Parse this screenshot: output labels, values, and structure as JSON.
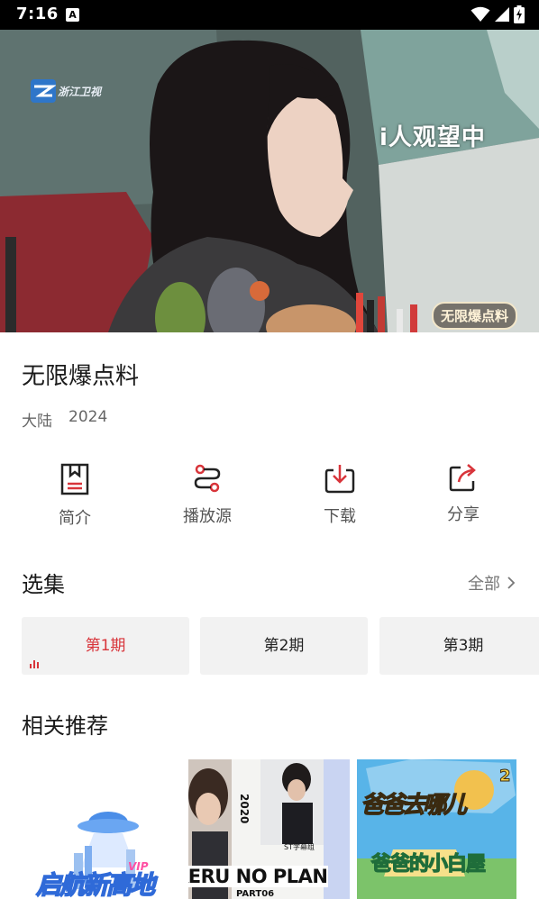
{
  "status_bar": {
    "time": "7:16",
    "notification_icon_letter": "A",
    "icons": [
      "wifi-icon",
      "signal-icon",
      "battery-charging-icon"
    ]
  },
  "player": {
    "channel_watermark": "浙江卫视",
    "viewer_status": "i人观望中",
    "show_logo": "无限爆点料"
  },
  "show": {
    "title": "无限爆点料",
    "region": "大陆",
    "year": "2024"
  },
  "actions": [
    {
      "label": "简介",
      "icon": "document-icon"
    },
    {
      "label": "播放源",
      "icon": "route-icon"
    },
    {
      "label": "下载",
      "icon": "download-icon"
    },
    {
      "label": "分享",
      "icon": "share-icon"
    }
  ],
  "episodes": {
    "title": "选集",
    "see_all": "全部",
    "items": [
      {
        "label": "第1期",
        "active": true
      },
      {
        "label": "第2期",
        "active": false
      },
      {
        "label": "第3期",
        "active": false
      }
    ]
  },
  "recommendations": {
    "title": "相关推荐",
    "posters": [
      {
        "title_art": "启航新高地",
        "badge": "VIP"
      },
      {
        "title_art": "KERU NO PLAN",
        "year_art": "2020",
        "sub_art": "PART06",
        "caption_art": "ST字幕组"
      },
      {
        "title_art": "爸爸的小白屋",
        "top_art": "爸爸去哪儿",
        "badge": "2"
      }
    ]
  },
  "colors": {
    "accent": "#d8343a",
    "card_bg": "#f2f2f2",
    "status_bar_bg": "#000000"
  }
}
